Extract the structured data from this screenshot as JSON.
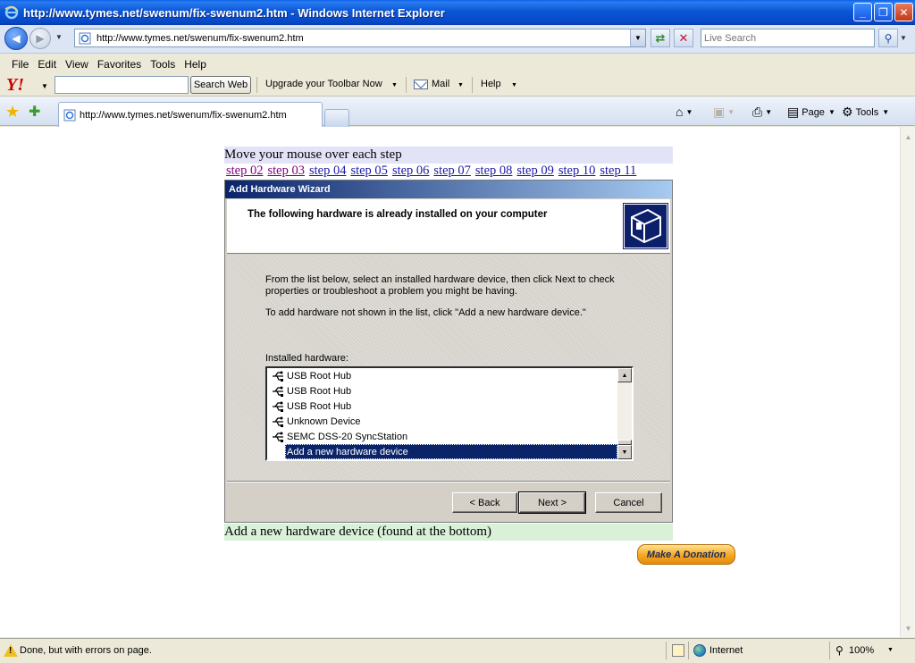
{
  "window": {
    "title": "http://www.tymes.net/swenum/fix-swenum2.htm - Windows Internet Explorer",
    "minimize": "_",
    "maximize": "❐",
    "close": "✕"
  },
  "address_bar": {
    "url": "http://www.tymes.net/swenum/fix-swenum2.htm",
    "search_placeholder": "Live Search"
  },
  "menu": {
    "items": [
      "File",
      "Edit",
      "View",
      "Favorites",
      "Tools",
      "Help"
    ]
  },
  "yahoo_toolbar": {
    "logo": "Y!",
    "search_button": "Search Web",
    "upgrade": "Upgrade your Toolbar Now",
    "mail": "Mail",
    "help": "Help"
  },
  "tabs": {
    "active_tab": "http://www.tymes.net/swenum/fix-swenum2.htm"
  },
  "commands": {
    "page": "Page",
    "tools": "Tools"
  },
  "page": {
    "step_header": "Move your mouse over each step",
    "steps": [
      "step 02",
      "step 03",
      "step 04",
      "step 05",
      "step 06",
      "step 07",
      "step 08",
      "step 09",
      "step 10",
      "step 11"
    ],
    "bottom_caption": "Add a new hardware device (found at the bottom)",
    "donate_label": "Make A Donation"
  },
  "wizard": {
    "title": "Add Hardware Wizard",
    "heading": "The following hardware is already installed on your computer",
    "description1": "From the list below, select an installed hardware device, then click Next to check properties or troubleshoot a problem you might be having.",
    "description2": "To add hardware not shown in the list, click \"Add a new hardware device.\"",
    "installed_label": "Installed hardware:",
    "items": [
      "USB Root Hub",
      "USB Root Hub",
      "USB Root Hub",
      "Unknown Device",
      "SEMC DSS-20 SyncStation"
    ],
    "selected_item": "Add a new hardware device",
    "back_button": "< Back",
    "next_button": "Next >",
    "cancel_button": "Cancel"
  },
  "status_bar": {
    "message": "Done, but with errors on page.",
    "zone": "Internet",
    "zoom": "100%"
  },
  "colors": {
    "xp_title_blue": "#0a57d6",
    "wizard_title_blue": "#0a246a",
    "link_blue": "#1a1aa8",
    "link_visited": "#800080"
  }
}
